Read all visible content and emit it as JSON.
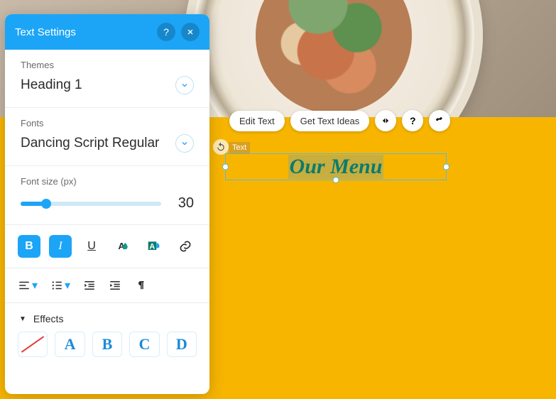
{
  "panel": {
    "title": "Text Settings",
    "themes": {
      "label": "Themes",
      "value": "Heading 1"
    },
    "fonts": {
      "label": "Fonts",
      "value": "Dancing Script Regular"
    },
    "fontsize": {
      "label": "Font size (px)",
      "value": "30"
    },
    "effects": {
      "label": "Effects",
      "options": [
        "A",
        "B",
        "C",
        "D"
      ]
    }
  },
  "toolbar": {
    "edit_text": "Edit Text",
    "get_ideas": "Get Text Ideas"
  },
  "canvas": {
    "element_label": "Text",
    "text_value": "Our Menu"
  },
  "colors": {
    "accent": "#1ca5f7",
    "canvas_bg": "#f7b500",
    "text_color": "#0d7a6e"
  }
}
